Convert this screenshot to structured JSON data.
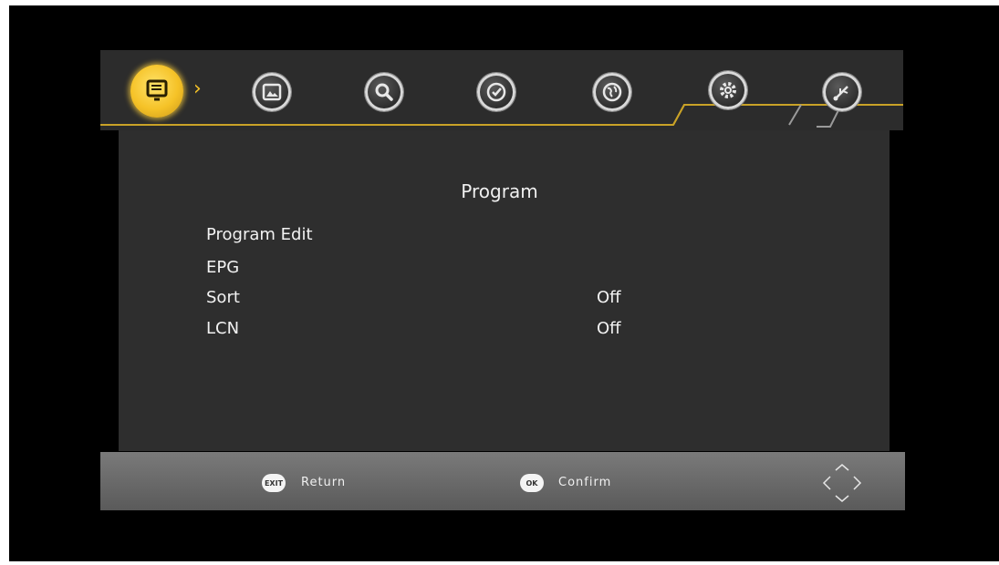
{
  "menu": {
    "icons": [
      "program-icon",
      "picture-icon",
      "search-icon",
      "time-icon",
      "language-icon",
      "settings-icon",
      "usb-icon"
    ],
    "active_index": 0,
    "accent_color": "#f5c227"
  },
  "panel": {
    "title": "Program",
    "items": [
      {
        "label": "Program Edit",
        "value": ""
      },
      {
        "label": "EPG",
        "value": ""
      },
      {
        "label": "Sort",
        "value": "Off"
      },
      {
        "label": "LCN",
        "value": "Off"
      }
    ]
  },
  "footer": {
    "return_key": "EXIT",
    "return_label": "Return",
    "confirm_key": "OK",
    "confirm_label": "Confirm"
  }
}
